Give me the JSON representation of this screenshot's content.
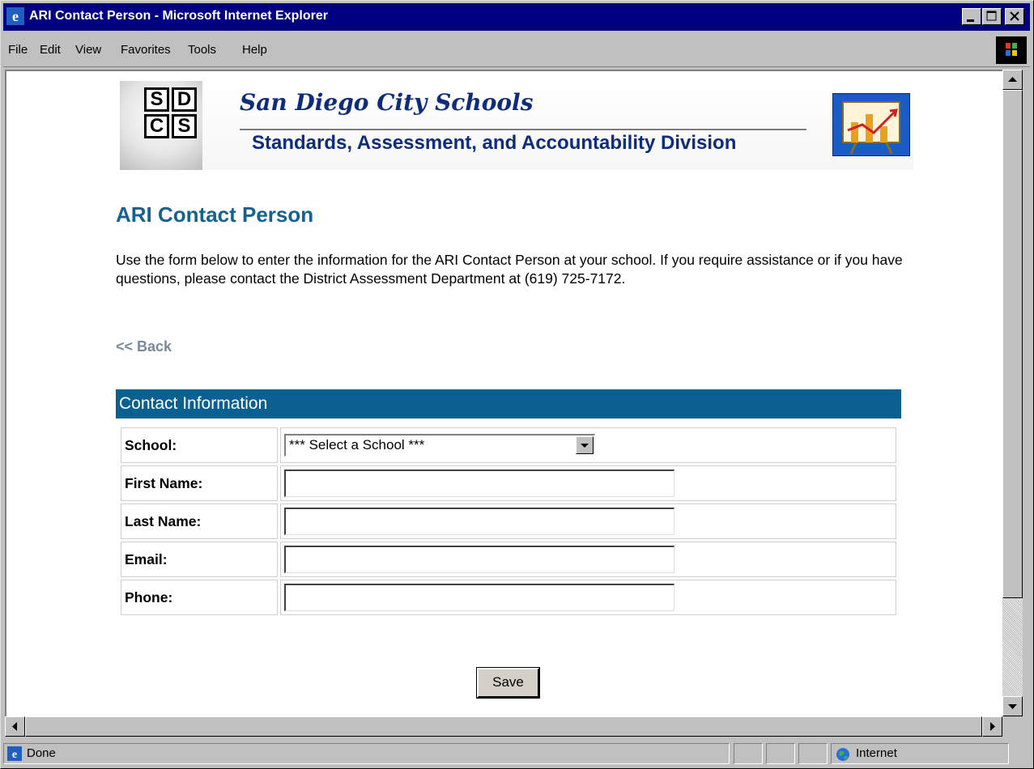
{
  "window": {
    "title": "ARI Contact Person - Microsoft Internet Explorer"
  },
  "menu": {
    "items": [
      "File",
      "Edit",
      "View",
      "Favorites",
      "Tools",
      "Help"
    ]
  },
  "banner": {
    "logo_letters": [
      "S",
      "D",
      "C",
      "S"
    ],
    "title": "San Diego City Schools",
    "subtitle": "Standards, Assessment, and Accountability Division"
  },
  "page": {
    "heading": "ARI Contact Person",
    "intro": "Use the form below to enter the information for the ARI Contact Person at your school. If you require assistance or if you have questions, please contact the District Assessment Department at (619) 725-7172.",
    "back_link": "<< Back"
  },
  "form": {
    "section_title": "Contact Information",
    "fields": [
      {
        "label": "School:",
        "type": "select",
        "value": "*** Select a School ***"
      },
      {
        "label": "First Name:",
        "type": "text",
        "value": ""
      },
      {
        "label": "Last Name:",
        "type": "text",
        "value": ""
      },
      {
        "label": "Email:",
        "type": "text",
        "value": ""
      },
      {
        "label": "Phone:",
        "type": "text",
        "value": ""
      }
    ],
    "save_label": "Save"
  },
  "status": {
    "left": "Done",
    "zone": "Internet"
  },
  "colors": {
    "titlebar": "#000080",
    "heading": "#14628f",
    "section_header": "#0a6090",
    "banner_text": "#0d2c7a",
    "back_link": "#7a8a9a"
  }
}
